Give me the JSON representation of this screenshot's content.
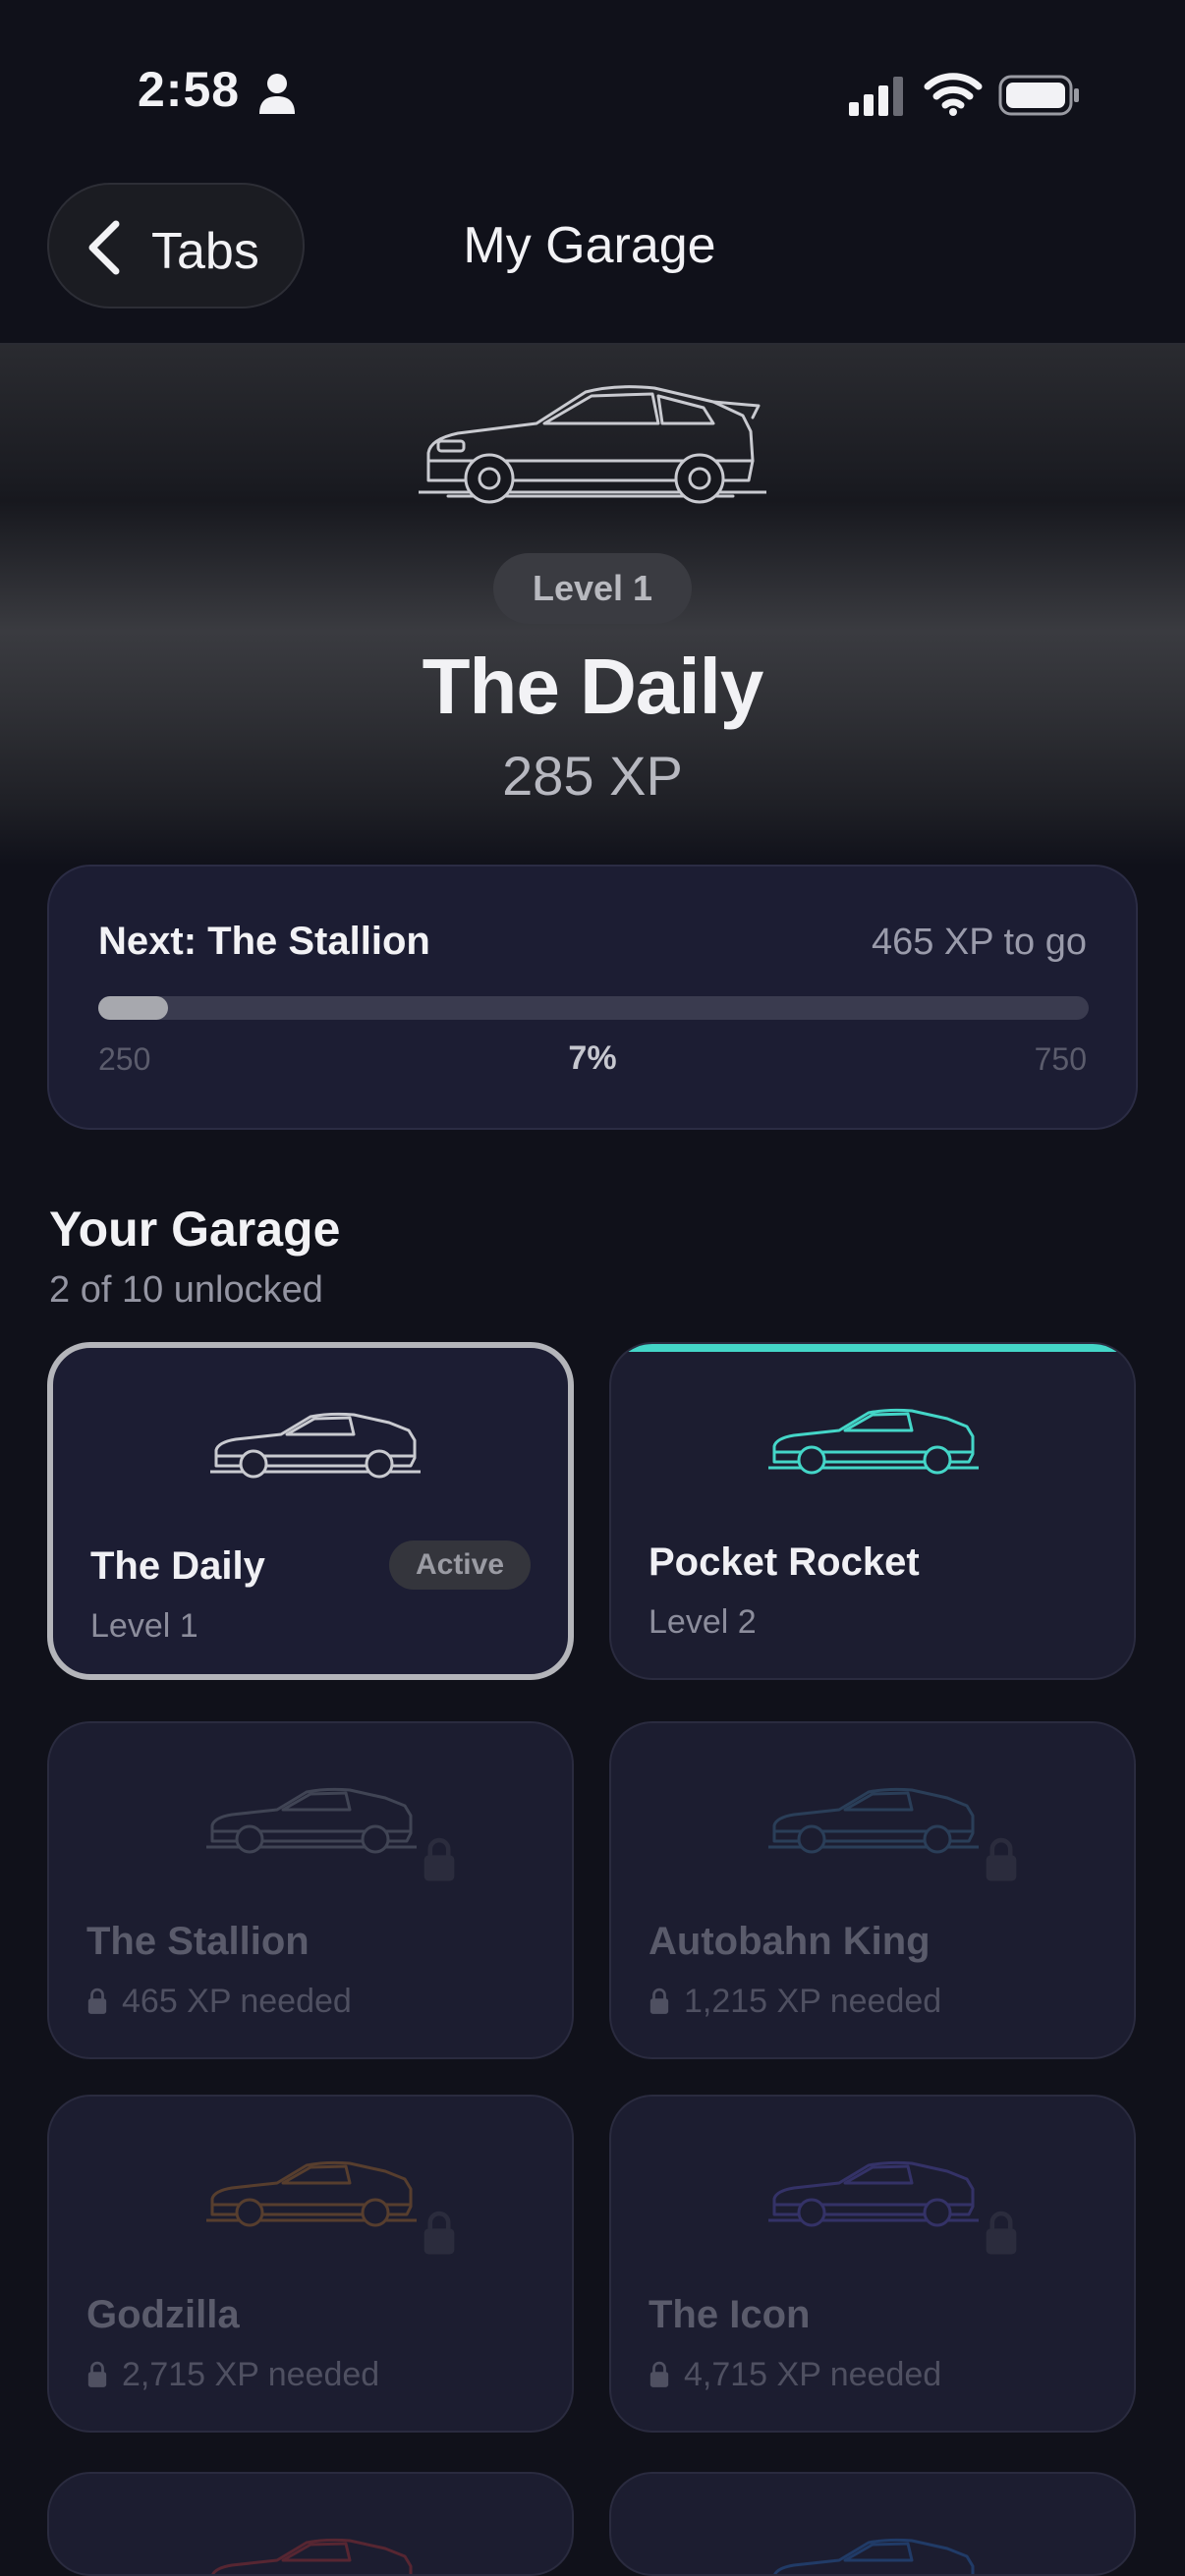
{
  "status_bar": {
    "time": "2:58",
    "icons": [
      "person-icon",
      "cellular-signal-icon",
      "wifi-icon",
      "battery-icon"
    ]
  },
  "nav": {
    "back_label": "Tabs",
    "title": "My Garage",
    "back_icon": "chevron-left-icon"
  },
  "hero": {
    "level": "Level 1",
    "name": "The Daily",
    "xp": "285 XP",
    "car_icon": "car-outline-icon"
  },
  "progress": {
    "next_label": "Next: The Stallion",
    "to_go": "465 XP to go",
    "min": "250",
    "max": "750",
    "percent_label": "7%",
    "fraction": 0.07
  },
  "garage": {
    "title": "Your Garage",
    "subtitle": "2 of 10 unlocked",
    "cars": [
      {
        "name": "The Daily",
        "sub": "Level 1",
        "badge": "Active",
        "state": "active",
        "color": "#c9cad0"
      },
      {
        "name": "Pocket Rocket",
        "sub": "Level 2",
        "state": "unlocked",
        "color": "#44d6c8"
      },
      {
        "name": "The Stallion",
        "sub": "465 XP needed",
        "state": "locked",
        "color": "#4d5260"
      },
      {
        "name": "Autobahn King",
        "sub": "1,215 XP needed",
        "state": "locked",
        "color": "#2f4a66"
      },
      {
        "name": "Godzilla",
        "sub": "2,715 XP needed",
        "state": "locked",
        "color": "#6b4a2e"
      },
      {
        "name": "The Icon",
        "sub": "4,715 XP needed",
        "state": "locked",
        "color": "#3d3a7a"
      },
      {
        "name": "",
        "sub": "",
        "state": "locked",
        "color": "#6b2a33"
      },
      {
        "name": "",
        "sub": "",
        "state": "locked",
        "color": "#23457a"
      }
    ]
  },
  "colors": {
    "background": "#10111a",
    "card": "#1c1d30",
    "accent_teal": "#44d6c8",
    "progress_fill": "#a7a8ae"
  }
}
